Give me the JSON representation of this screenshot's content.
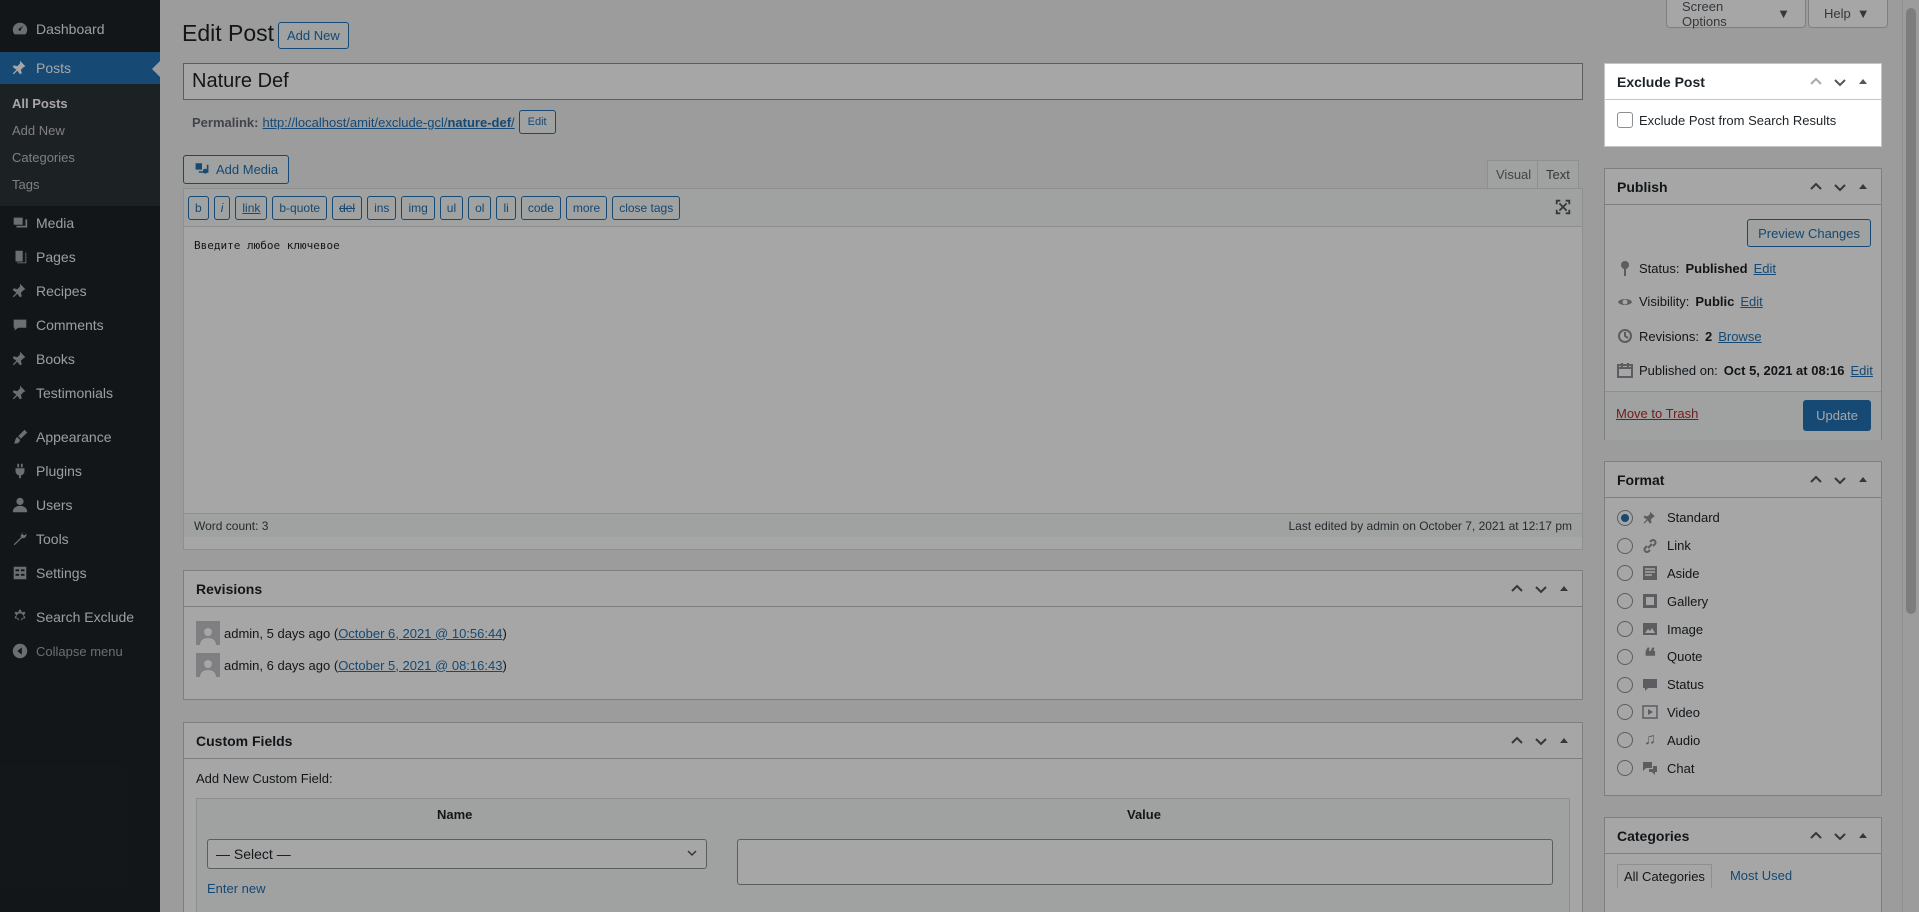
{
  "sidebar": {
    "items": [
      {
        "label": "Dashboard",
        "icon": "dashboard-icon"
      },
      {
        "label": "Posts",
        "icon": "pin-icon",
        "active": true
      },
      {
        "label": "Media",
        "icon": "media-icon"
      },
      {
        "label": "Pages",
        "icon": "pages-icon"
      },
      {
        "label": "Recipes",
        "icon": "pin-icon"
      },
      {
        "label": "Comments",
        "icon": "comment-icon"
      },
      {
        "label": "Books",
        "icon": "pin-icon"
      },
      {
        "label": "Testimonials",
        "icon": "pin-icon"
      },
      {
        "label": "Appearance",
        "icon": "brush-icon"
      },
      {
        "label": "Plugins",
        "icon": "plugin-icon"
      },
      {
        "label": "Users",
        "icon": "user-icon"
      },
      {
        "label": "Tools",
        "icon": "wrench-icon"
      },
      {
        "label": "Settings",
        "icon": "settings-icon"
      },
      {
        "label": "Search Exclude",
        "icon": "gear-icon"
      },
      {
        "label": "Collapse menu",
        "icon": "collapse-icon"
      }
    ],
    "submenu": [
      "All Posts",
      "Add New",
      "Categories",
      "Tags"
    ]
  },
  "header": {
    "title": "Edit Post",
    "add_new": "Add New",
    "screen_options": "Screen Options",
    "help": "Help"
  },
  "post": {
    "title": "Nature Def",
    "permalink_label": "Permalink:",
    "permalink_base": "http://localhost/amit/exclude-gcl/",
    "permalink_slug": "nature-def",
    "permalink_end": "/",
    "permalink_edit": "Edit"
  },
  "editor": {
    "add_media": "Add Media",
    "tab_visual": "Visual",
    "tab_text": "Text",
    "quicktags": [
      "b",
      "i",
      "link",
      "b-quote",
      "del",
      "ins",
      "img",
      "ul",
      "ol",
      "li",
      "code",
      "more",
      "close tags"
    ],
    "content": "Введите любое ключевое",
    "word_count": "Word count: 3",
    "last_edited": "Last edited by admin on October 7, 2021 at 12:17 pm"
  },
  "revisions": {
    "title": "Revisions",
    "rows": [
      {
        "prefix": "admin, 5 days ago (",
        "link": "October 6, 2021 @ 10:56:44",
        "suffix": ")"
      },
      {
        "prefix": "admin, 6 days ago (",
        "link": "October 5, 2021 @ 08:16:43",
        "suffix": ")"
      }
    ]
  },
  "custom_fields": {
    "title": "Custom Fields",
    "add_label": "Add New Custom Field:",
    "col_name": "Name",
    "col_value": "Value",
    "select_value": "— Select —",
    "enter_new": "Enter new"
  },
  "exclude_box": {
    "title": "Exclude Post",
    "checkbox_label": "Exclude Post from Search Results"
  },
  "publish": {
    "title": "Publish",
    "preview": "Preview Changes",
    "status_label": "Status:",
    "status_value": "Published",
    "visibility_label": "Visibility:",
    "visibility_value": "Public",
    "revisions_label": "Revisions:",
    "revisions_value": "2",
    "browse": "Browse",
    "published_label": "Published on:",
    "published_value": "Oct 5, 2021 at 08:16",
    "edit": "Edit",
    "trash": "Move to Trash",
    "update": "Update"
  },
  "format": {
    "title": "Format",
    "options": [
      "Standard",
      "Link",
      "Aside",
      "Gallery",
      "Image",
      "Quote",
      "Status",
      "Video",
      "Audio",
      "Chat"
    ],
    "selected": "Standard"
  },
  "categories": {
    "title": "Categories",
    "tab_all": "All Categories",
    "tab_most": "Most Used"
  },
  "colors": {
    "accent": "#2271b1",
    "sidebar_bg": "#1d2327",
    "danger": "#b32d2e"
  }
}
